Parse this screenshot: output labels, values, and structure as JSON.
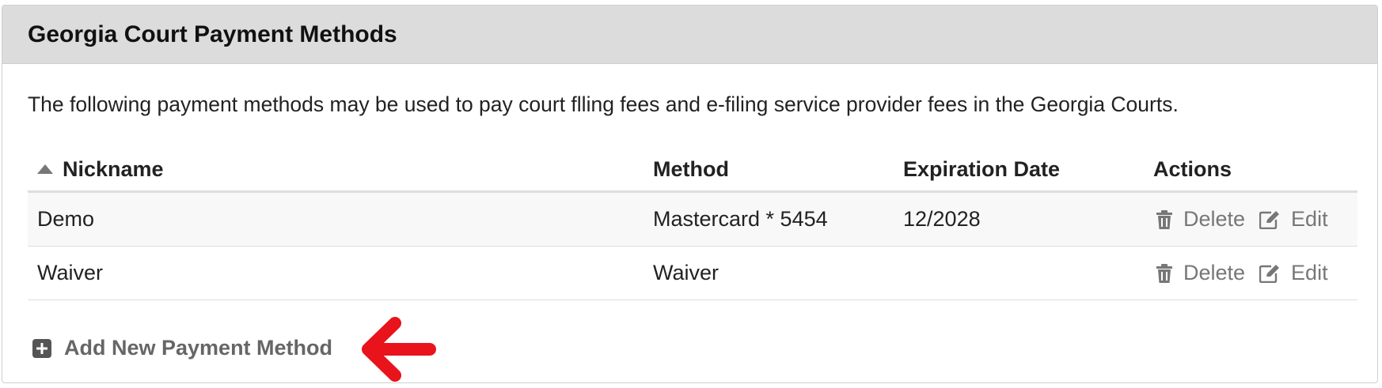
{
  "panel": {
    "title": "Georgia Court Payment Methods",
    "intro": "The following payment methods may be used to pay court flling fees and e-filing service provider fees in the Georgia Courts."
  },
  "table": {
    "headers": {
      "nickname": "Nickname",
      "method": "Method",
      "expiration": "Expiration Date",
      "actions": "Actions"
    },
    "rows": [
      {
        "nickname": "Demo",
        "method": "Mastercard * 5454",
        "expiration": "12/2028",
        "delete_label": "Delete",
        "edit_label": "Edit"
      },
      {
        "nickname": "Waiver",
        "method": "Waiver",
        "expiration": "",
        "delete_label": "Delete",
        "edit_label": "Edit"
      }
    ]
  },
  "add_payment": {
    "label": "Add New Payment Method"
  },
  "icons": {
    "sort": "sort-ascending-icon",
    "delete": "trash-icon",
    "edit": "edit-icon",
    "add": "plus-square-icon",
    "annotation": "red-arrow-icon"
  },
  "colors": {
    "header_bg": "#dcdcdc",
    "action_gray": "#777777",
    "annotation_red": "#e8131b"
  }
}
